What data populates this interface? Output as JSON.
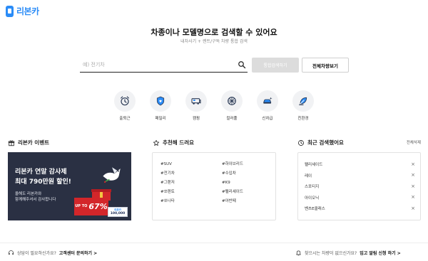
{
  "brand": {
    "name": "리본카",
    "accent": "#2b8cf7"
  },
  "hero": {
    "title": "차종이나 모델명으로 검색할 수 있어요",
    "subtitle": "내차사기 + 렌트/구독 차량 통합 검색"
  },
  "search": {
    "placeholder": "예) 전기차",
    "value": "",
    "search_button": "통합검색하기",
    "view_all_button": "전체차량보기"
  },
  "categories": [
    {
      "label": "출퇴근",
      "icon": "clock-icon"
    },
    {
      "label": "패밀리",
      "icon": "shield-heart-icon"
    },
    {
      "label": "캠핑",
      "icon": "camper-van-icon"
    },
    {
      "label": "컬러풀",
      "icon": "color-wheel-icon"
    },
    {
      "label": "신차급",
      "icon": "new-car-icon"
    },
    {
      "label": "친환경",
      "icon": "eco-leaf-icon"
    }
  ],
  "event": {
    "heading": "리본카 이벤트",
    "banner": {
      "line1": "리본카 연말 감사제",
      "line2": "최대 790만원 할인!",
      "line3": "올해도 리본카와",
      "line4": "함께해주셔서 감사합니다",
      "up_label": "UP TO",
      "percent": "67%",
      "tag_top": "리본카",
      "tag_value": "100,000",
      "bg_color": "#2a3043"
    }
  },
  "recommend": {
    "heading": "추천해 드려요",
    "tags": [
      "#SUV",
      "#하이브리드",
      "#전기차",
      "#수입차",
      "#그랜저",
      "#K9",
      "#쏘렌토",
      "#팰리세이드",
      "#쏘나타",
      "#아반떼"
    ]
  },
  "recent": {
    "heading": "최근 검색했어요",
    "delete_all": "전체삭제",
    "items": [
      "팰리세이드",
      "레이",
      "스포티지",
      "아이오닉",
      "벤츠E클래스"
    ],
    "remove_symbol": "×"
  },
  "footer": {
    "left_question": "상담이 필요하신가요?",
    "left_action": "고객센터 문의하기 >",
    "right_question": "찾으시는 차량이 없으신가요?",
    "right_action": "입고 알림 신청 하기 >"
  }
}
